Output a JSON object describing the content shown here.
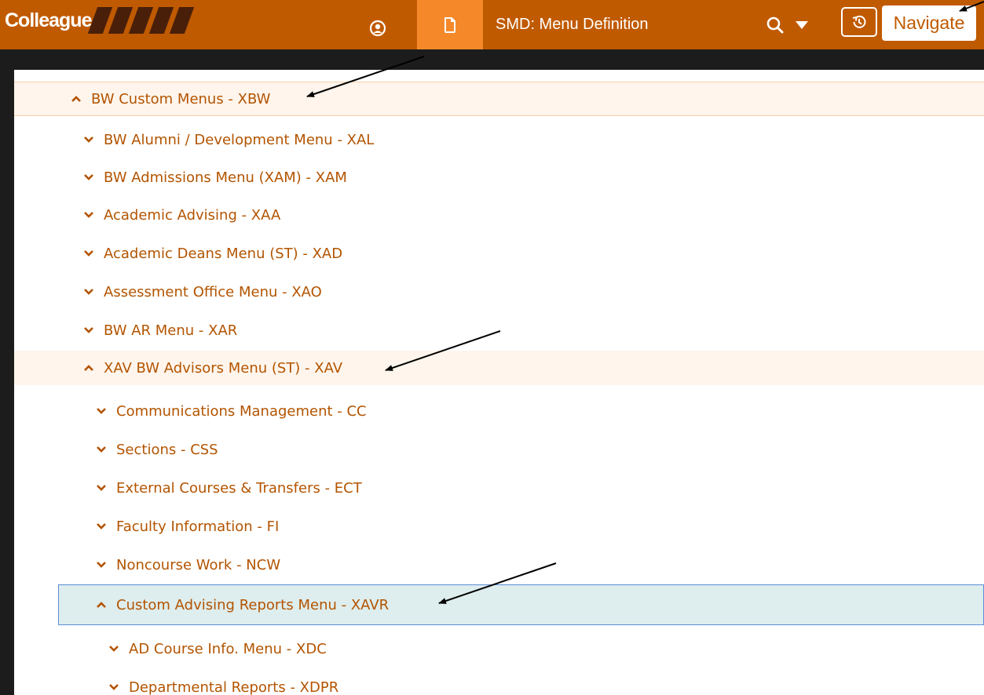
{
  "header": {
    "logo_text": "Colleague",
    "form_title": "SMD: Menu Definition",
    "navigate_label": "Navigate"
  },
  "tree": {
    "items": [
      {
        "label": "BW Custom Menus - XBW",
        "state": "expanded"
      },
      {
        "label": "BW Alumni / Development Menu - XAL",
        "state": "collapsed"
      },
      {
        "label": "BW Admissions Menu (XAM) - XAM",
        "state": "collapsed"
      },
      {
        "label": "Academic Advising - XAA",
        "state": "collapsed"
      },
      {
        "label": "Academic Deans Menu (ST) - XAD",
        "state": "collapsed"
      },
      {
        "label": "Assessment Office Menu - XAO",
        "state": "collapsed"
      },
      {
        "label": "BW AR Menu - XAR",
        "state": "collapsed"
      },
      {
        "label": "XAV BW Advisors Menu (ST) - XAV",
        "state": "expanded"
      },
      {
        "label": "Communications Management - CC",
        "state": "collapsed"
      },
      {
        "label": "Sections - CSS",
        "state": "collapsed"
      },
      {
        "label": "External Courses & Transfers - ECT",
        "state": "collapsed"
      },
      {
        "label": "Faculty Information - FI",
        "state": "collapsed"
      },
      {
        "label": "Noncourse Work - NCW",
        "state": "collapsed"
      },
      {
        "label": "Custom Advising Reports Menu - XAVR",
        "state": "expanded-selected"
      },
      {
        "label": "AD Course Info. Menu - XDC",
        "state": "collapsed"
      },
      {
        "label": "Departmental Reports - XDPR",
        "state": "collapsed"
      }
    ]
  },
  "colors": {
    "header_bg": "#c05a00",
    "active_tab_bg": "#f5892a",
    "link_text": "#b35400",
    "expanded_bg": "#fff5ec",
    "selected_bg": "#deeded",
    "selected_border": "#5b8ed6"
  },
  "icons": {
    "user": "user-circle-icon",
    "document": "document-icon",
    "search": "search-icon",
    "dropdown": "caret-down-icon",
    "history": "history-icon",
    "expanded": "chevron-up-icon",
    "collapsed": "chevron-down-icon"
  }
}
